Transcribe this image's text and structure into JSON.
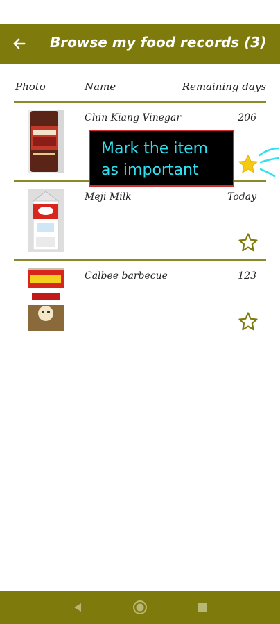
{
  "header": {
    "title": "Browse my food records (3)",
    "back_icon": "arrow-left-icon",
    "background_color": "#7e7a0c"
  },
  "columns": {
    "photo": "Photo",
    "name": "Name",
    "remaining": "Remaining days"
  },
  "items": [
    {
      "name": "Chin Kiang Vinegar",
      "remaining": "206",
      "important": true,
      "photo_icon": "vinegar-bottle-photo"
    },
    {
      "name": "Meji Milk",
      "remaining": "Today",
      "important": false,
      "photo_icon": "milk-carton-photo"
    },
    {
      "name": "Calbee barbecue",
      "remaining": "123",
      "important": false,
      "photo_icon": "chips-bag-photo"
    }
  ],
  "tooltip": {
    "line1": "Mark the item",
    "line2": "as important",
    "text_color": "#2ee0f0"
  },
  "colors": {
    "accent": "#7e7a0c",
    "star_filled": "#f6c915",
    "star_outline": "#7e7a0c"
  },
  "nav": {
    "back_icon": "triangle-back-icon",
    "home_icon": "circle-home-icon",
    "recents_icon": "square-recents-icon"
  }
}
